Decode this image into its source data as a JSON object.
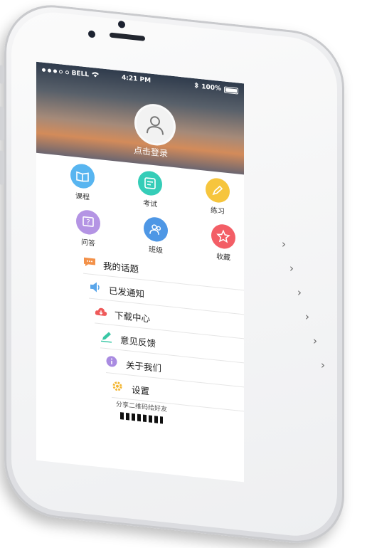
{
  "status_bar": {
    "carrier": "BELL",
    "time": "4:21 PM",
    "battery": "100%"
  },
  "profile": {
    "login_label": "点击登录"
  },
  "grid": [
    {
      "label": "课程",
      "icon": "book-icon",
      "color": "#58b5f0"
    },
    {
      "label": "考试",
      "icon": "exam-icon",
      "color": "#35cdb8"
    },
    {
      "label": "练习",
      "icon": "pencil-icon",
      "color": "#f6c53d"
    },
    {
      "label": "问答",
      "icon": "question-icon",
      "color": "#b494e4"
    },
    {
      "label": "班级",
      "icon": "group-icon",
      "color": "#4e97e5"
    },
    {
      "label": "收藏",
      "icon": "star-icon",
      "color": "#f35e66"
    }
  ],
  "menu": [
    {
      "label": "我的话题",
      "icon": "chat-icon",
      "color": "#f39149"
    },
    {
      "label": "已发通知",
      "icon": "speaker-icon",
      "color": "#5aa6ea"
    },
    {
      "label": "下载中心",
      "icon": "download-cloud-icon",
      "color": "#ef5a5a"
    },
    {
      "label": "意见反馈",
      "icon": "feedback-pen-icon",
      "color": "#39c7a5"
    },
    {
      "label": "关于我们",
      "icon": "info-icon",
      "color": "#a98be1"
    },
    {
      "label": "设置",
      "icon": "gear-icon",
      "color": "#f3b52f"
    }
  ],
  "share": {
    "label": "分享二维码给好友"
  }
}
